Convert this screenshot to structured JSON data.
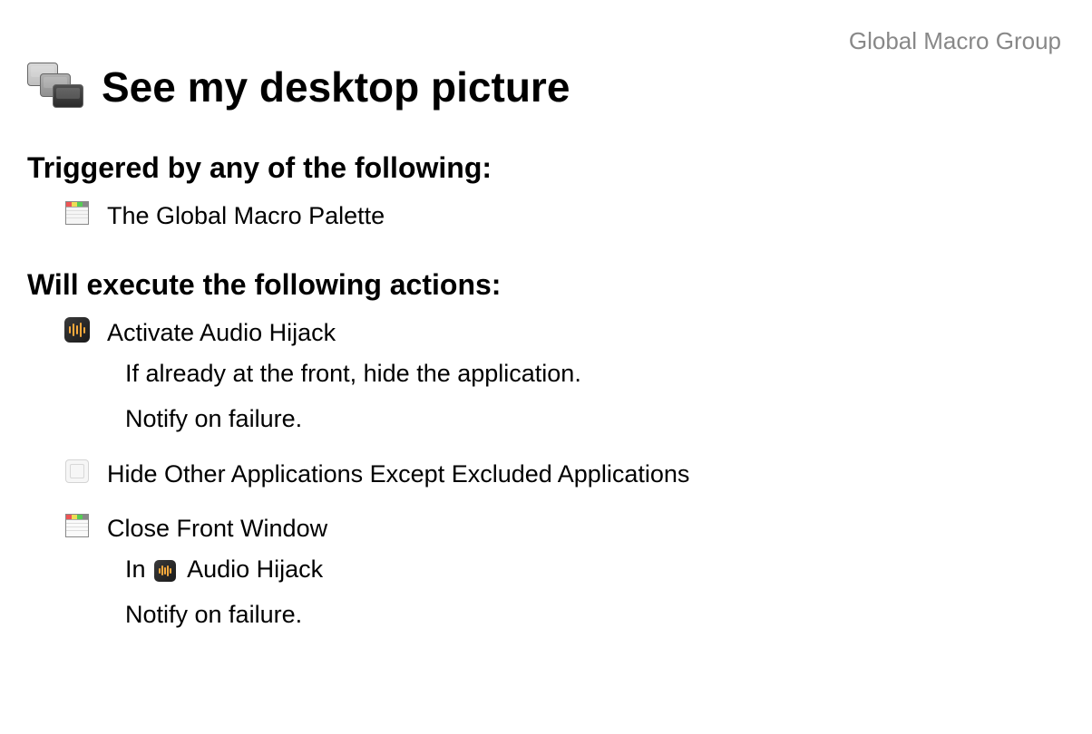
{
  "header": {
    "group_label": "Global Macro Group"
  },
  "macro": {
    "title": "See my desktop picture"
  },
  "triggers": {
    "heading": "Triggered by any of the following:",
    "items": [
      {
        "label": "The Global Macro Palette"
      }
    ]
  },
  "actions": {
    "heading": "Will execute the following actions:",
    "items": [
      {
        "label": "Activate Audio Hijack",
        "details": [
          "If already at the front, hide the application.",
          "Notify on failure."
        ]
      },
      {
        "label": "Hide Other Applications Except Excluded Applications",
        "details": []
      },
      {
        "label": "Close Front Window",
        "in_prefix": "In",
        "in_app": "Audio Hijack",
        "details": [
          "Notify on failure."
        ]
      }
    ]
  }
}
